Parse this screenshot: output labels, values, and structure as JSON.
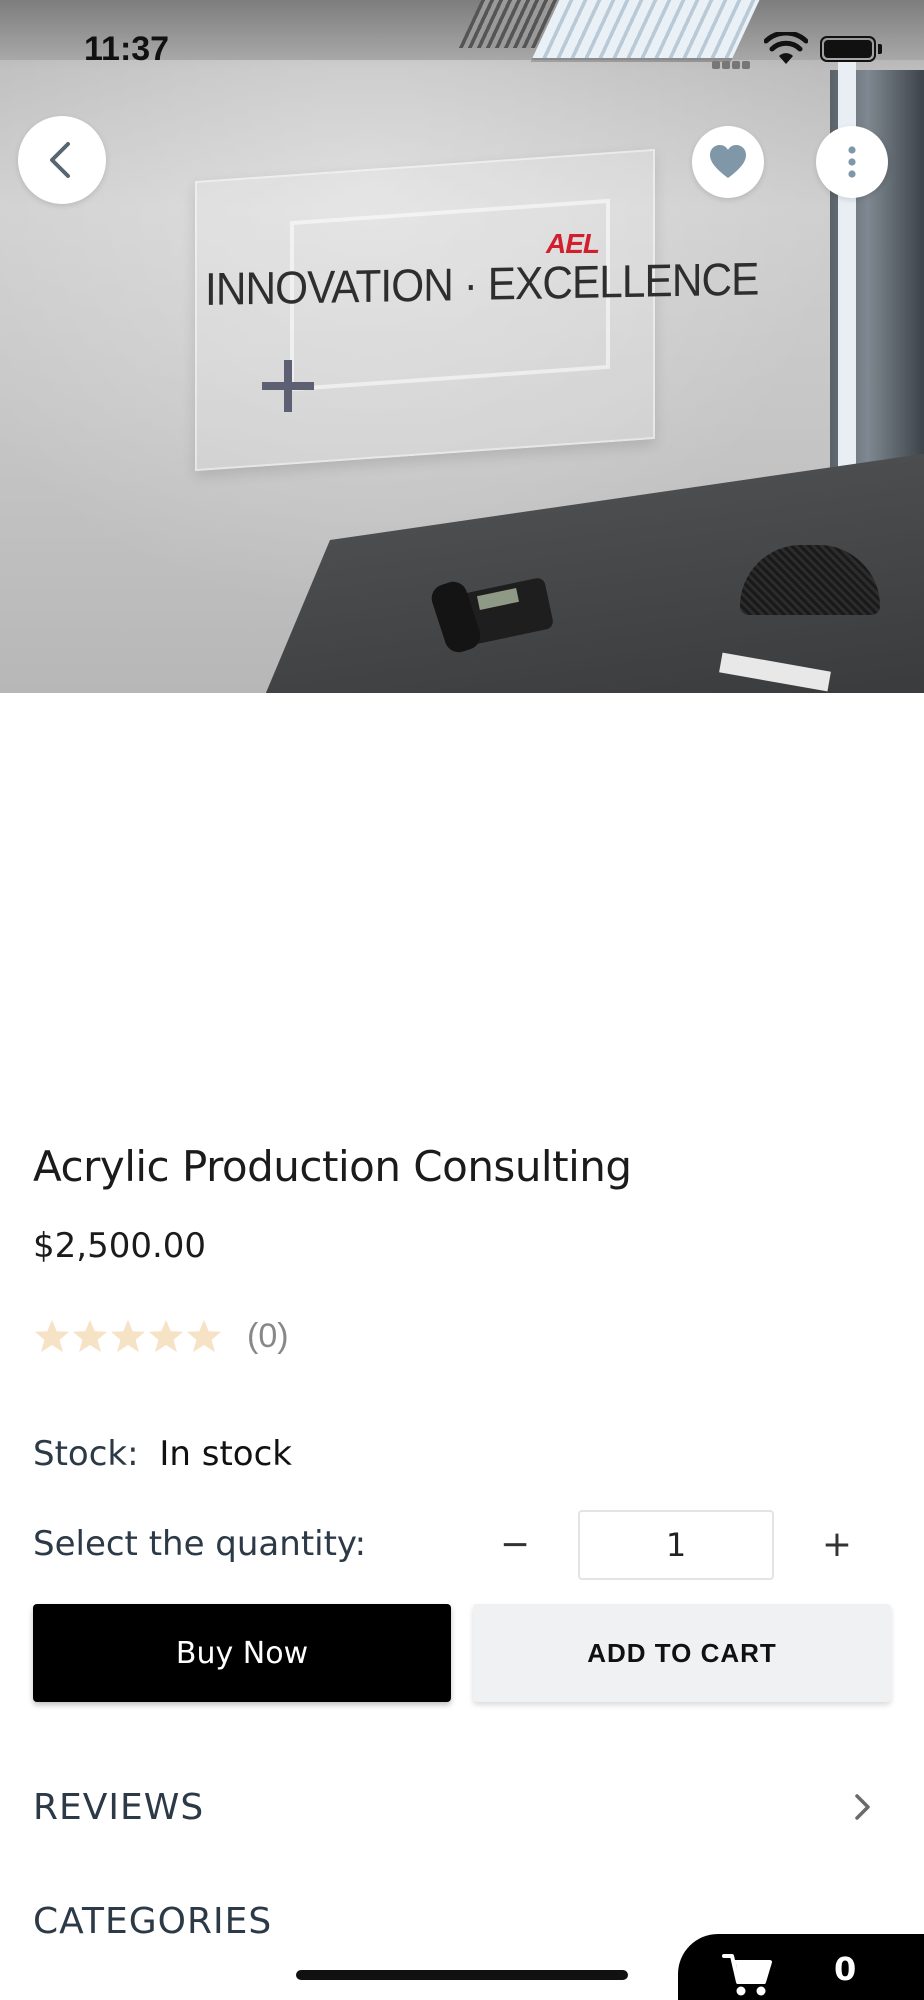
{
  "status_bar": {
    "time": "11:37"
  },
  "hero_image": {
    "sign_brand": "AEL",
    "sign_text": "INNOVATION · EXCELLENCE",
    "icons": [
      "back-icon",
      "heart-icon",
      "more-vertical-icon"
    ]
  },
  "product": {
    "title": "Acrylic Production Consulting",
    "price": "$2,500.00",
    "rating": {
      "stars_filled": 0,
      "stars_total": 5,
      "count_label": "(0)"
    },
    "stock": {
      "label": "Stock:",
      "value": "In stock"
    },
    "quantity": {
      "label": "Select the quantity:",
      "minus": "−",
      "value": "1",
      "plus": "+"
    }
  },
  "actions": {
    "buy_now": "Buy Now",
    "add_to_cart": "ADD TO CART"
  },
  "sections": {
    "reviews": "REVIEWS",
    "categories": "CATEGORIES"
  },
  "cart": {
    "count": "0"
  },
  "colors": {
    "primary_button": "#000000",
    "secondary_button": "#f0f1f3",
    "star_empty": "#f6e3c6",
    "heading_text": "#2c3946"
  }
}
